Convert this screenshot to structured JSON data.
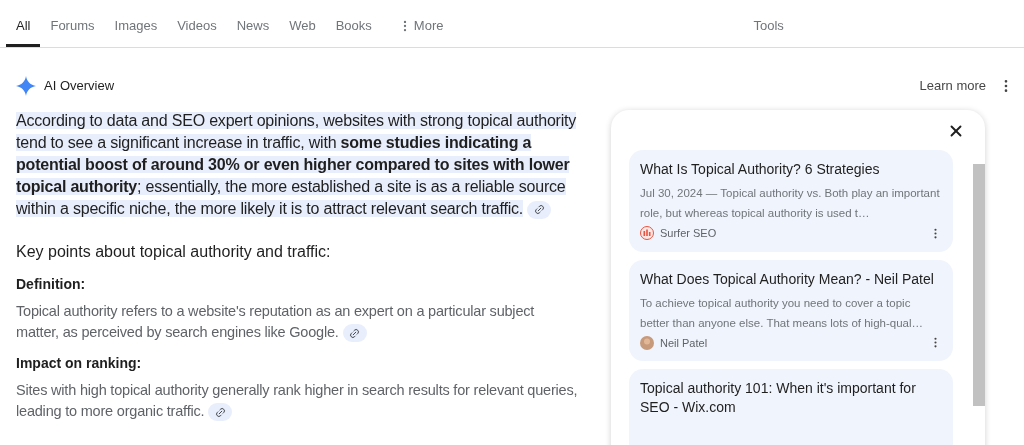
{
  "tabs": [
    {
      "label": "All",
      "selected": true
    },
    {
      "label": "Forums",
      "selected": false
    },
    {
      "label": "Images",
      "selected": false
    },
    {
      "label": "Videos",
      "selected": false
    },
    {
      "label": "News",
      "selected": false
    },
    {
      "label": "Web",
      "selected": false
    },
    {
      "label": "Books",
      "selected": false
    },
    {
      "label": "More",
      "selected": false
    }
  ],
  "tools": "Tools",
  "overview": {
    "title": "AI Overview",
    "learn_more": "Learn more",
    "summary": "According to data and SEO expert opinions, websites with strong topical authority tend to see a significant increase in traffic, with **some studies indicating a potential boost of around 30% or even higher compared to sites with lower topical authority**; essentially, the more established a site is as a reliable source within a specific niche, the more likely it is to attract relevant search traffic.",
    "key_points_title": "Key points about topical authority and traffic:",
    "key_points": [
      {
        "heading": "Definition:",
        "text": "Topical authority refers to a website's reputation as an expert on a particular subject matter, as perceived by search engines like Google."
      },
      {
        "heading": "Impact on ranking:",
        "text": "Sites with high topical authority generally rank higher in search results for relevant queries, leading to more organic traffic."
      }
    ]
  },
  "sources": [
    {
      "title": "What Is Topical Authority? 6 Strategies",
      "snippet": "Jul 30, 2024 — Topical authority vs. Both play an important role, but whereas topical authority is used t…",
      "site": "Surfer SEO",
      "kind": "logo"
    },
    {
      "title": "What Does Topical Authority Mean? - Neil Patel",
      "snippet": "To achieve topical authority you need to cover a topic better than anyone else. That means lots of high-qual…",
      "site": "Neil Patel",
      "kind": "avatar"
    },
    {
      "title": "Topical authority 101: When it's important for SEO - Wix.com"
    }
  ]
}
